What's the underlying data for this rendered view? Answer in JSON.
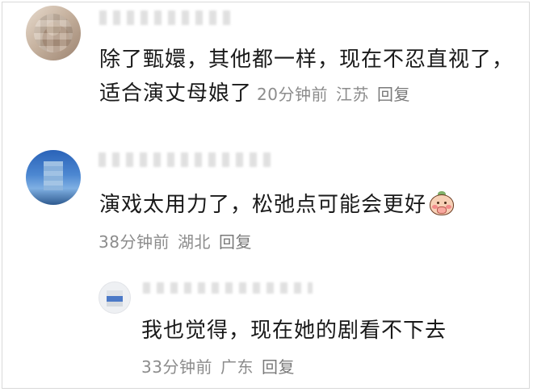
{
  "comments": [
    {
      "text": "除了甄嬛，其他都一样，现在不忍直视了，适合演丈母娘了",
      "time": "20分钟前",
      "location": "江苏",
      "reply_label": "回复"
    },
    {
      "text": "演戏太用力了，松弛点可能会更好",
      "emoji": "blushing-peach-emoji",
      "time": "38分钟前",
      "location": "湖北",
      "reply_label": "回复"
    },
    {
      "text": "我也觉得，现在她的剧看不下去",
      "time": "33分钟前",
      "location": "广东",
      "reply_label": "回复"
    }
  ],
  "colors": {
    "text": "#1a1a1a",
    "meta": "#8c8c8c",
    "border": "#d9d9d9"
  }
}
